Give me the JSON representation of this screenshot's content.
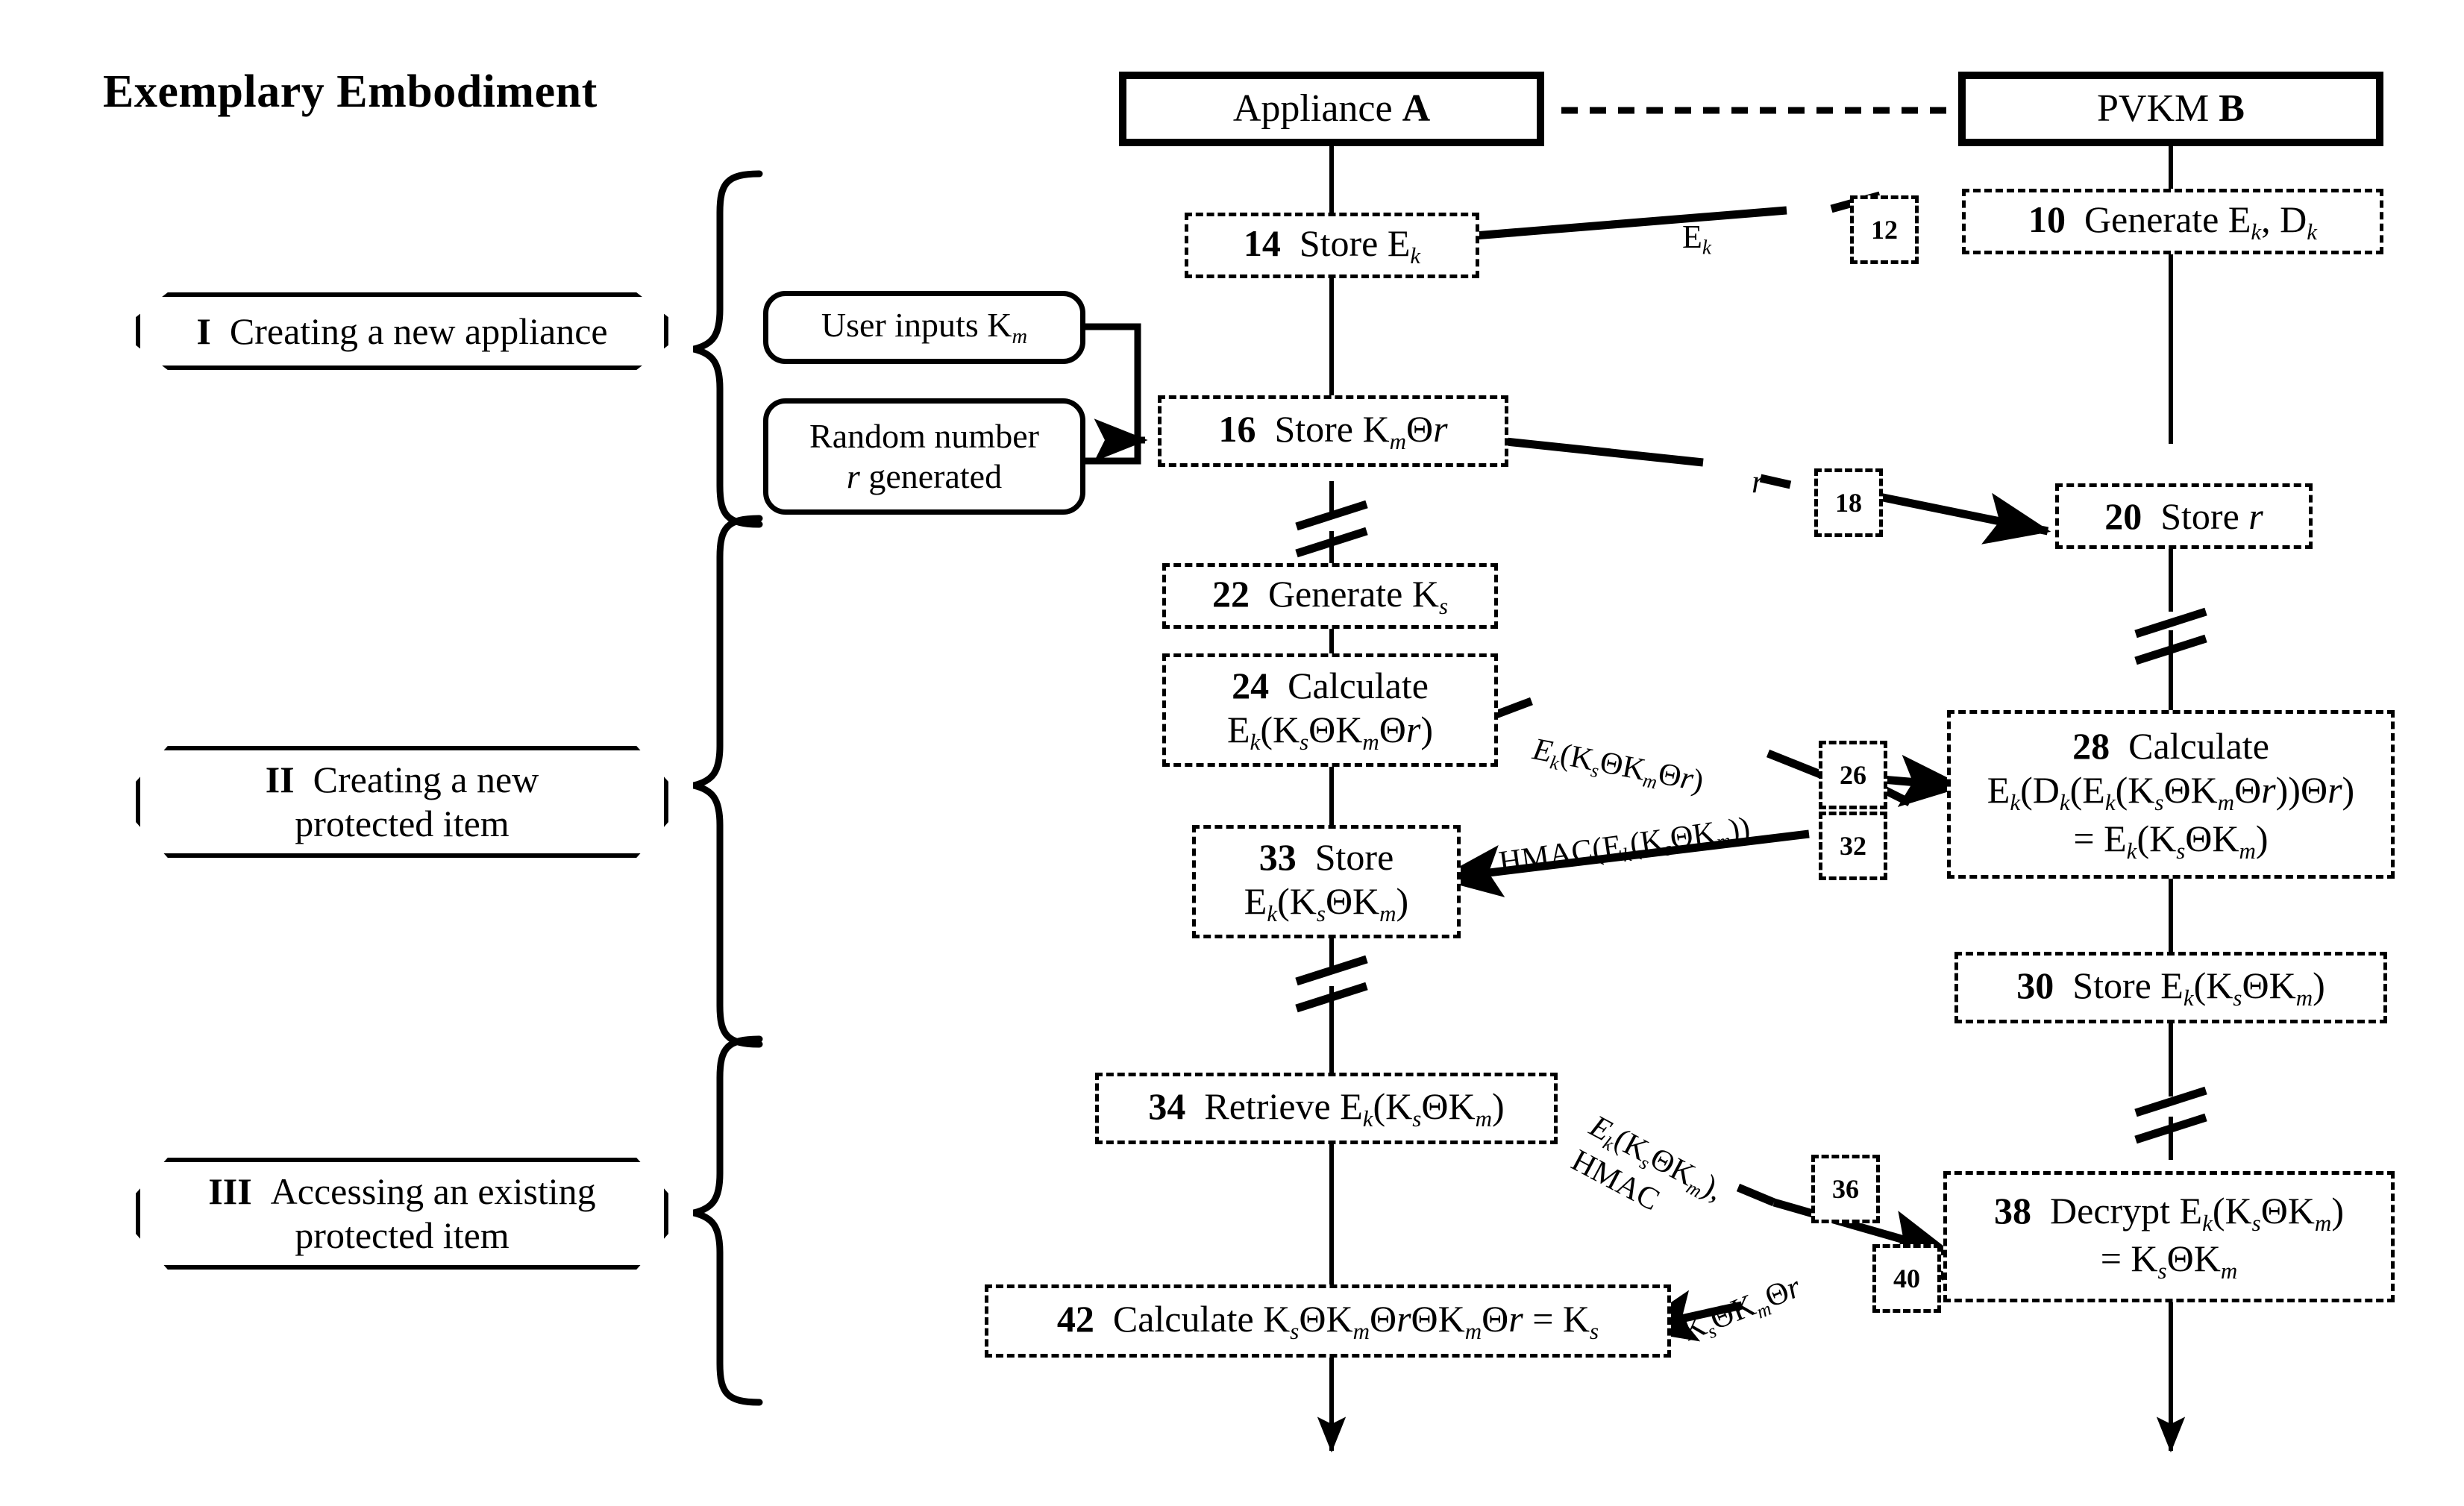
{
  "title": "Exemplary Embodiment",
  "entities": [
    {
      "id": "appliance",
      "name_plain": "Appliance ",
      "name_bold": "A",
      "label": "Appliance A"
    },
    {
      "id": "pvkm",
      "name_plain": "PVKM ",
      "name_bold": "B",
      "label": "PVKM B"
    }
  ],
  "phases": [
    {
      "numeral": "I",
      "text": "Creating a new appliance",
      "lines": [
        "Creating a new appliance"
      ]
    },
    {
      "numeral": "II",
      "text": "Creating a new protected item",
      "lines": [
        "Creating a new",
        "protected item"
      ]
    },
    {
      "numeral": "III",
      "text": "Accessing an existing protected item",
      "lines": [
        "Accessing an existing",
        "protected item"
      ]
    }
  ],
  "inputs": [
    {
      "id": "user-input",
      "lines": [
        "User inputs K",
        "m"
      ],
      "label": "User inputs Km"
    },
    {
      "id": "random-number",
      "lines": [
        "Random number",
        "r generated"
      ],
      "label": "Random number r generated"
    }
  ],
  "steps": [
    {
      "num": "10",
      "text": "Generate Ek, Dk",
      "column": "pvkm",
      "label": "10 Generate Ek, Dk"
    },
    {
      "num": "14",
      "text": "Store Ek",
      "column": "appliance",
      "label": "14 Store Ek"
    },
    {
      "num": "16",
      "text": "Store KmΘr",
      "column": "appliance",
      "label": "16 Store KmΘr"
    },
    {
      "num": "20",
      "text": "Store r",
      "column": "pvkm",
      "label": "20 Store r"
    },
    {
      "num": "22",
      "text": "Generate Ks",
      "column": "appliance",
      "label": "22 Generate Ks"
    },
    {
      "num": "24",
      "text": "Calculate Ek(KsΘKmΘr)",
      "column": "appliance",
      "label": "24 Calculate Ek(KsΘKmΘr)"
    },
    {
      "num": "28",
      "text": "Calculate Ek(Dk(Ek(KsΘKmΘr))Θr) = Ek(KsΘKm)",
      "column": "pvkm",
      "label": "28 Calculate Ek(Dk(Ek(KsΘKmΘr))Θr) = Ek(KsΘKm)"
    },
    {
      "num": "30",
      "text": "Store Ek(KsΘKm)",
      "column": "pvkm",
      "label": "30 Store Ek(KsΘKm)"
    },
    {
      "num": "33",
      "text": "Store Ek(KsΘKm)",
      "column": "appliance",
      "label": "33 Store Ek(KsΘKm)"
    },
    {
      "num": "34",
      "text": "Retrieve Ek(KsΘKm)",
      "column": "appliance",
      "label": "34 Retrieve Ek(KsΘKm)"
    },
    {
      "num": "38",
      "text": "Decrypt Ek(KsΘKm) = KsΘKm",
      "column": "pvkm",
      "label": "38 Decrypt Ek(KsΘKm) = KsΘKm"
    },
    {
      "num": "42",
      "text": "Calculate KsΘKmΘrΘKmΘr = Ks",
      "column": "appliance",
      "label": "42 Calculate KsΘKmΘrΘKmΘr = Ks"
    }
  ],
  "messages": [
    {
      "tag": "12",
      "payload": "Ek",
      "from": "pvkm",
      "to": "appliance"
    },
    {
      "tag": "18",
      "payload": "r",
      "from": "appliance",
      "to": "pvkm"
    },
    {
      "tag": "26",
      "payload": "Ek(KsΘKmΘr)",
      "from": "appliance",
      "to": "pvkm"
    },
    {
      "tag": "32",
      "payload": "HMAC(Ek(KsΘKm))",
      "from": "pvkm",
      "to": "appliance"
    },
    {
      "tag": "36",
      "payload": "Ek(KsΘKm), HMAC",
      "from": "appliance",
      "to": "pvkm"
    },
    {
      "tag": "40",
      "payload": "KsΘKmΘr",
      "from": "pvkm",
      "to": "appliance"
    }
  ],
  "text": {
    "step10_num": "10",
    "step10_body_a": "Generate E",
    "step10_body_b": "k",
    "step10_body_c": ", D",
    "step10_body_d": "k",
    "step14_num": "14",
    "step14_body": "Store E",
    "step14_sub": "k",
    "step16_num": "16",
    "step16_body": "Store K",
    "step16_sub": "m",
    "step16_tail": "Θ",
    "step16_r": "r",
    "step20_num": "20",
    "step20_body": "Store ",
    "step20_r": "r",
    "step22_num": "22",
    "step22_body": "Generate K",
    "step22_sub": "s",
    "step24_num": "24",
    "step24_l1": "Calculate",
    "step28_num": "28",
    "step28_l1": "Calculate",
    "step30_num": "30",
    "step30_body": "Store E",
    "step33_num": "33",
    "step33_l1": "Store",
    "step34_num": "34",
    "step34_body": "Retrieve E",
    "step38_num": "38",
    "step38_l1a": "Decrypt E",
    "step42_num": "42",
    "step42_body": "Calculate K",
    "tag12": "12",
    "tag18": "18",
    "tag26": "26",
    "tag32": "32",
    "tag36": "36",
    "tag40": "40",
    "msg12_label": "E",
    "msg12_sub": "k",
    "msg18_label": "r",
    "msg40_label": "K"
  },
  "colors": {
    "ink": "#000000",
    "paper": "#ffffff"
  },
  "symbols": {
    "xor": "Θ",
    "break_mark": "double-slash"
  }
}
